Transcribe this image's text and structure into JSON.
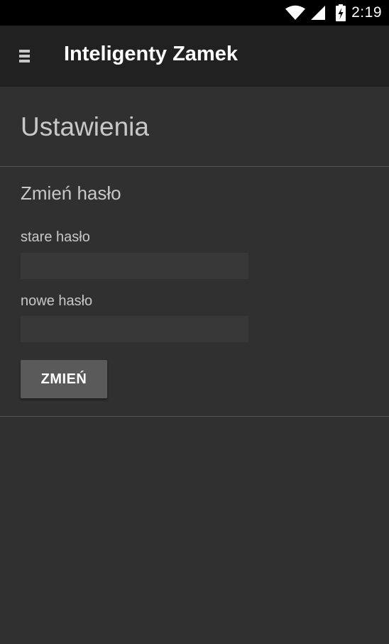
{
  "status_bar": {
    "time": "2:19",
    "icons": [
      "wifi-icon",
      "cellular-signal-icon",
      "battery-charging-icon"
    ]
  },
  "toolbar": {
    "menu_icon": "hamburger-menu-icon",
    "title": "Inteligenty Zamek"
  },
  "page": {
    "title": "Ustawienia"
  },
  "change_password": {
    "section_title": "Zmień hasło",
    "old_password_label": "stare hasło",
    "old_password_value": "",
    "new_password_label": "nowe hasło",
    "new_password_value": "",
    "submit_label": "ZMIEŃ"
  },
  "colors": {
    "status_bar": "#000000",
    "toolbar": "#212121",
    "background": "#303030",
    "input": "#383838",
    "button": "#5a5a5a",
    "text_primary": "#ffffff",
    "text_secondary": "#c8c8c8"
  }
}
